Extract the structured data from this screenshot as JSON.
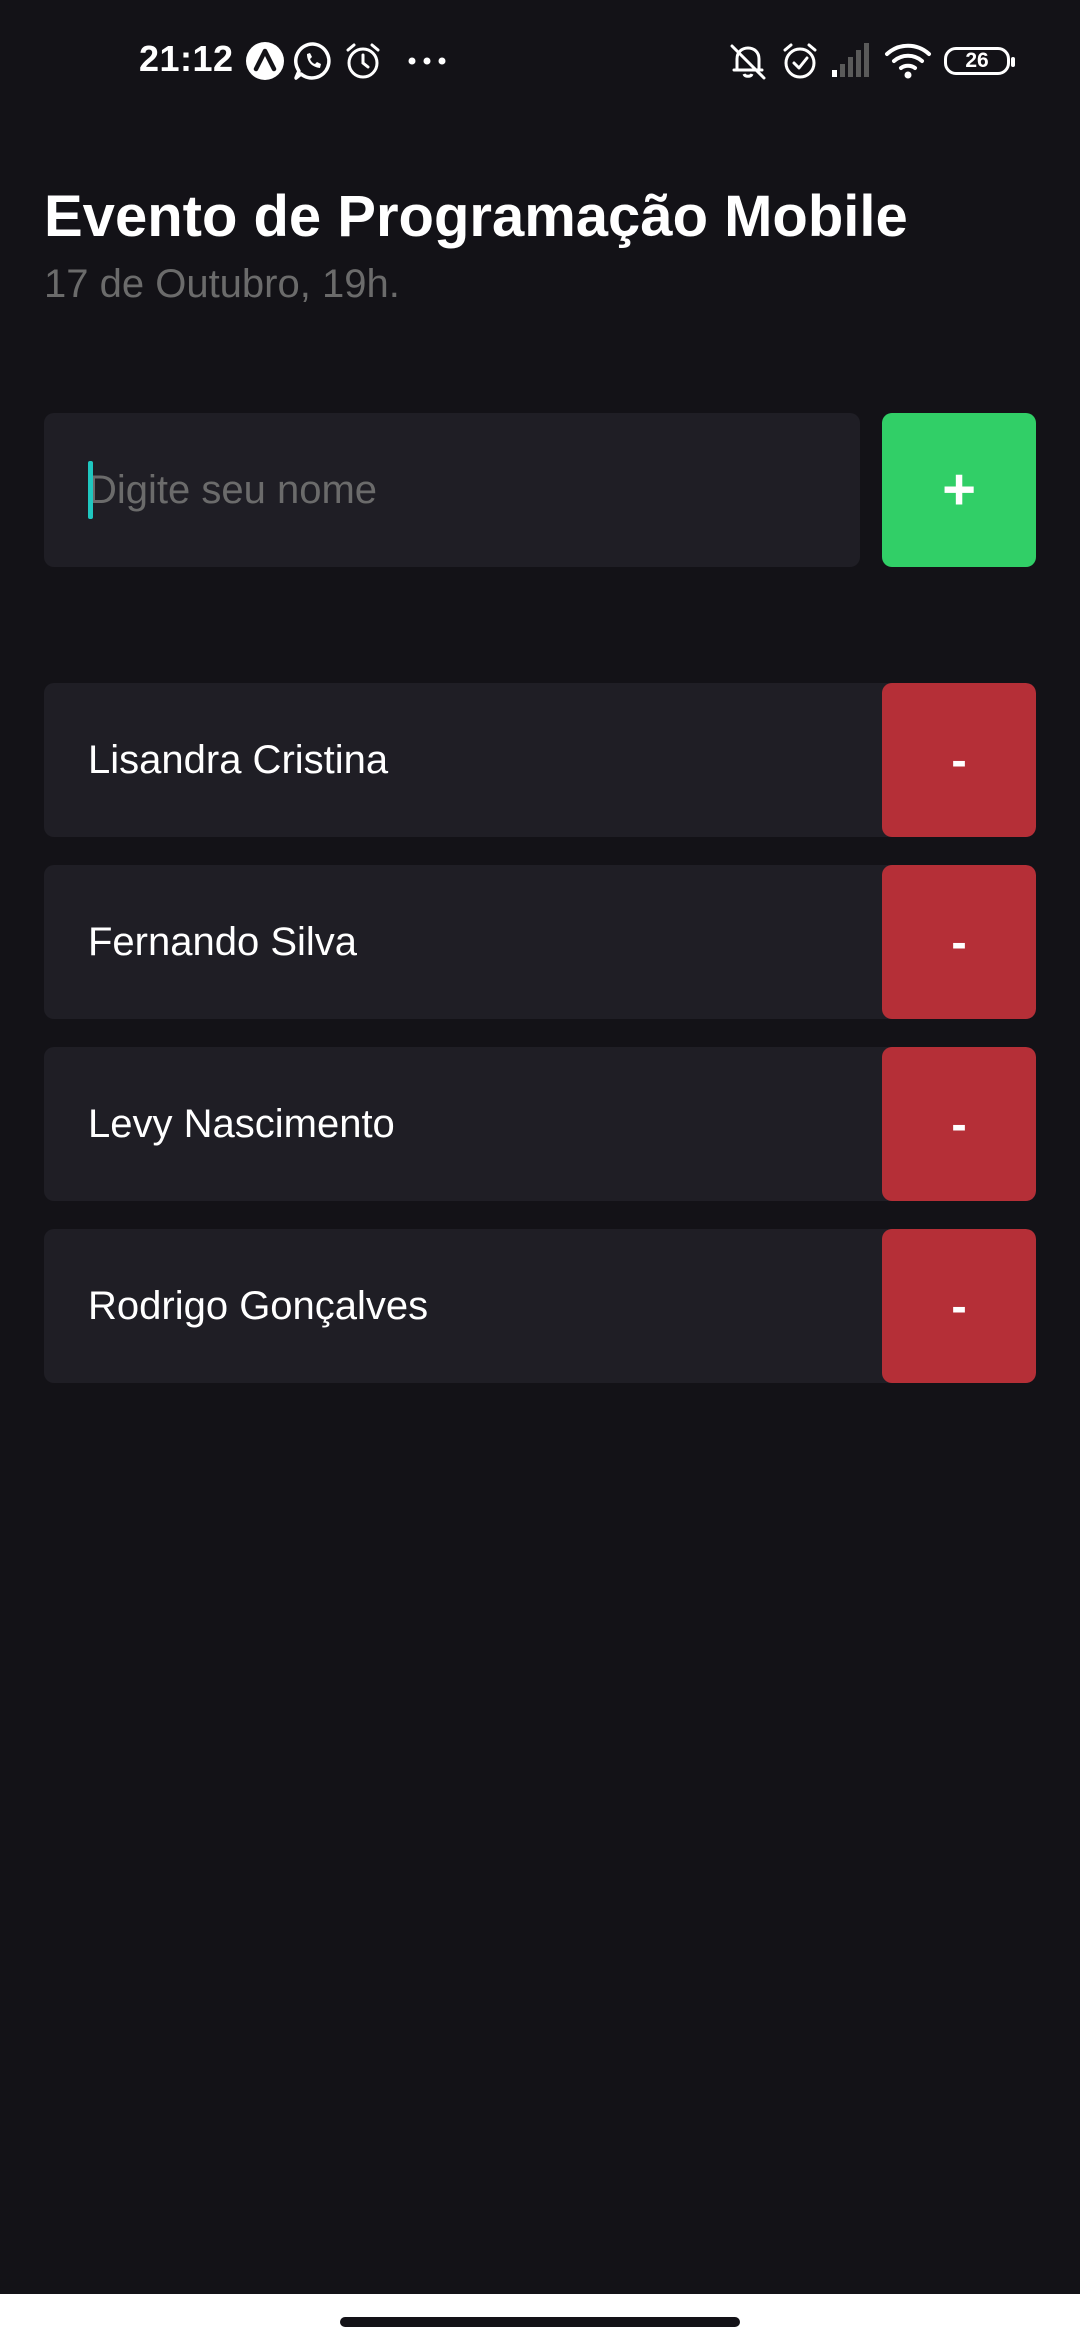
{
  "status_bar": {
    "time": "21:12",
    "battery": "26",
    "left_icons": [
      "app-a-icon",
      "whatsapp-icon",
      "alarm-icon",
      "more-dots-icon"
    ],
    "right_icons": [
      "silent-bell-icon",
      "alarm-icon",
      "signal-icon",
      "wifi-icon",
      "battery-icon"
    ]
  },
  "header": {
    "title": "Evento de Programação Mobile",
    "subtitle": "17 de Outubro, 19h."
  },
  "form": {
    "placeholder": "Digite seu nome",
    "value": "",
    "add_label": "+"
  },
  "participants": [
    {
      "name": "Lisandra Cristina",
      "remove_label": "-"
    },
    {
      "name": "Fernando Silva",
      "remove_label": "-"
    },
    {
      "name": "Levy Nascimento",
      "remove_label": "-"
    },
    {
      "name": "Rodrigo Gonçalves",
      "remove_label": "-"
    }
  ],
  "colors": {
    "background": "#131217",
    "card": "#1F1E25",
    "add_button": "#31CF67",
    "remove_button": "#B52F37",
    "subtitle": "#6B6B6B",
    "caret": "#1FC7C0"
  }
}
